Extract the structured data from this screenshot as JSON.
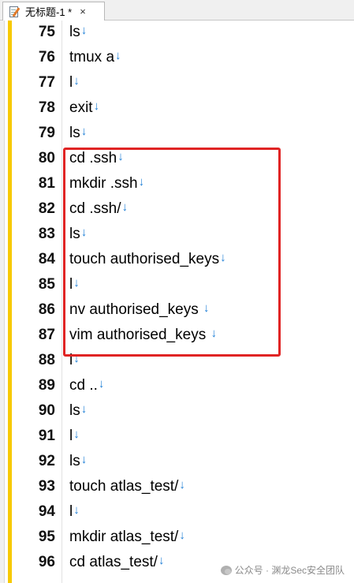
{
  "tab": {
    "title": "无标题-1 *",
    "close": "×"
  },
  "lines": [
    {
      "num": "75",
      "text": "ls",
      "eol": "↓"
    },
    {
      "num": "76",
      "text": "tmux a",
      "eol": "↓"
    },
    {
      "num": "77",
      "text": "l",
      "eol": "↓"
    },
    {
      "num": "78",
      "text": "exit",
      "eol": "↓"
    },
    {
      "num": "79",
      "text": "ls",
      "eol": "↓"
    },
    {
      "num": "80",
      "text": "cd .ssh",
      "eol": "↓"
    },
    {
      "num": "81",
      "text": "mkdir .ssh",
      "eol": "↓"
    },
    {
      "num": "82",
      "text": "cd .ssh/",
      "eol": "↓"
    },
    {
      "num": "83",
      "text": "ls",
      "eol": "↓"
    },
    {
      "num": "84",
      "text": "touch authorised_keys",
      "eol": "↓"
    },
    {
      "num": "85",
      "text": "l",
      "eol": "↓"
    },
    {
      "num": "86",
      "text": "nv authorised_keys ",
      "eol": "↓"
    },
    {
      "num": "87",
      "text": "vim authorised_keys ",
      "eol": "↓"
    },
    {
      "num": "88",
      "text": "l",
      "eol": "↓"
    },
    {
      "num": "89",
      "text": "cd ..",
      "eol": "↓"
    },
    {
      "num": "90",
      "text": "ls",
      "eol": "↓"
    },
    {
      "num": "91",
      "text": "l",
      "eol": "↓"
    },
    {
      "num": "92",
      "text": "ls",
      "eol": "↓"
    },
    {
      "num": "93",
      "text": "touch atlas_test/",
      "eol": "↓"
    },
    {
      "num": "94",
      "text": "l",
      "eol": "↓"
    },
    {
      "num": "95",
      "text": "mkdir atlas_test/",
      "eol": "↓"
    },
    {
      "num": "96",
      "text": "cd atlas_test/",
      "eol": "↓"
    }
  ],
  "watermark": {
    "text": "公众号 · 渊龙Sec安全团队"
  },
  "colors": {
    "highlight": "#e02424",
    "eol_marker": "#1e7fd6",
    "change_bar": "#f7c900"
  }
}
